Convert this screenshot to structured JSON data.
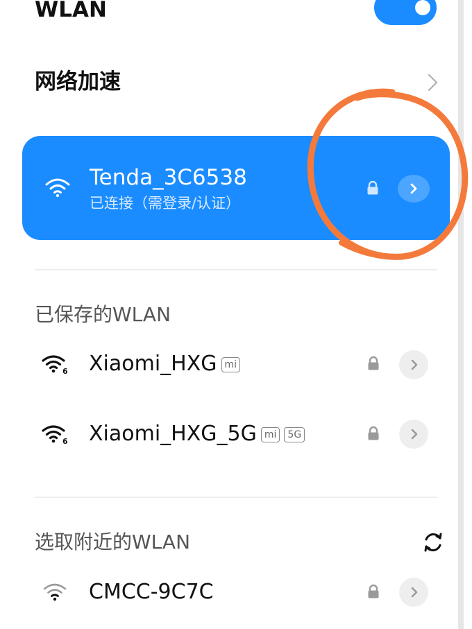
{
  "header": {
    "title": "WLAN",
    "toggle_on": true
  },
  "network_accel": {
    "label": "网络加速"
  },
  "connected": {
    "ssid": "Tenda_3C6538",
    "status": "已连接（需登录/认证）"
  },
  "saved": {
    "label": "已保存的WLAN",
    "items": [
      {
        "ssid": "Xiaomi_HXG",
        "badges": [
          "mi"
        ]
      },
      {
        "ssid": "Xiaomi_HXG_5G",
        "badges": [
          "mi",
          "5G"
        ]
      }
    ]
  },
  "nearby": {
    "label": "选取附近的WLAN",
    "items": [
      {
        "ssid": "CMCC-9C7C"
      }
    ]
  },
  "colors": {
    "accent": "#1a8cff",
    "annotation": "#f47a3c"
  },
  "icons": {
    "wifi": "wifi-icon",
    "wifi6": "wifi-6-icon",
    "lock": "lock-icon",
    "detail": "chevron-right-icon",
    "refresh": "refresh-icon"
  }
}
